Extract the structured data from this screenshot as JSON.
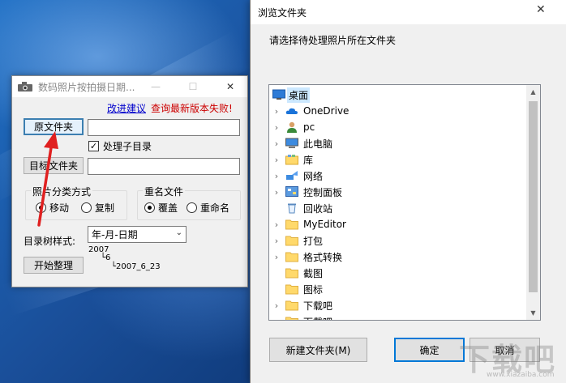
{
  "app": {
    "title": "数码照片按拍摄日期...",
    "link_suggest": "改进建议",
    "link_update": "查询最新版本失败!",
    "source_button": "原文件夹",
    "source_value": "",
    "subdir_label": "处理子目录",
    "subdir_checked": true,
    "target_button": "目标文件夹",
    "target_value": "",
    "mode_group": "照片分类方式",
    "mode_move": "移动",
    "mode_copy": "复制",
    "rename_group": "重名文件",
    "rename_overwrite": "覆盖",
    "rename_rename": "重命名",
    "tree_style_label": "目录树样式:",
    "tree_style_value": "年-月-日期",
    "tree_sample_year": "2007",
    "tree_sample_month": "└6",
    "tree_sample_day": "└2007_6_23",
    "start_button": "开始整理"
  },
  "dialog": {
    "title": "浏览文件夹",
    "close_glyph": "✕",
    "prompt": "请选择待处理照片所在文件夹",
    "tree": [
      {
        "label": "桌面",
        "expander": "",
        "icon": "desktop-icon",
        "selected": true
      },
      {
        "label": "OneDrive",
        "expander": "›",
        "icon": "onedrive-icon"
      },
      {
        "label": "pc",
        "expander": "›",
        "icon": "user-icon"
      },
      {
        "label": "此电脑",
        "expander": "›",
        "icon": "computer-icon"
      },
      {
        "label": "库",
        "expander": "›",
        "icon": "library-icon"
      },
      {
        "label": "网络",
        "expander": "›",
        "icon": "network-icon"
      },
      {
        "label": "控制面板",
        "expander": "›",
        "icon": "control-panel-icon"
      },
      {
        "label": "回收站",
        "expander": "",
        "icon": "recycle-bin-icon"
      },
      {
        "label": "MyEditor",
        "expander": "›",
        "icon": "folder-icon"
      },
      {
        "label": "打包",
        "expander": "›",
        "icon": "folder-icon"
      },
      {
        "label": "格式转换",
        "expander": "›",
        "icon": "folder-icon"
      },
      {
        "label": "截图",
        "expander": "",
        "icon": "folder-icon"
      },
      {
        "label": "图标",
        "expander": "",
        "icon": "folder-icon"
      },
      {
        "label": "下载吧",
        "expander": "›",
        "icon": "folder-icon"
      },
      {
        "label": "下载吧",
        "expander": "›",
        "icon": "folder-icon"
      }
    ],
    "new_folder_button": "新建文件夹(M)",
    "ok_button": "确定",
    "cancel_button": "取消"
  },
  "watermark": {
    "main": "下载吧",
    "sub": "www.xiazaiba.com"
  },
  "colors": {
    "link_blue": "#0000cc",
    "error_red": "#cc0000",
    "selection": "#cce8ff",
    "ok_border": "#0078d7",
    "arrow_red": "#e02020"
  }
}
